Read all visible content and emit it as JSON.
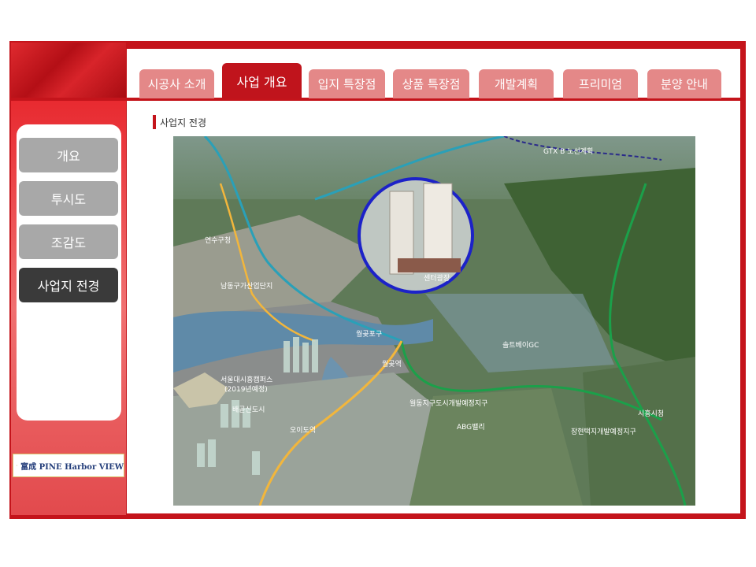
{
  "nav": {
    "tabs": [
      {
        "label": "시공사 소개"
      },
      {
        "label": "사업 개요"
      },
      {
        "label": "입지 특장점"
      },
      {
        "label": "상품 특장점"
      },
      {
        "label": "개발계획"
      },
      {
        "label": "프리미엄"
      },
      {
        "label": "분양 안내"
      }
    ],
    "active_tab": "사업 개요"
  },
  "sidebar": {
    "items": [
      {
        "label": "개요"
      },
      {
        "label": "투시도"
      },
      {
        "label": "조감도"
      },
      {
        "label": "사업지 전경"
      }
    ],
    "active_item": "사업지 전경"
  },
  "brand": {
    "name": "富成 PINE Harbor VIEW"
  },
  "section": {
    "title": "사업지 전경"
  },
  "map": {
    "labels": [
      "연수구청",
      "남동구가산업단지",
      "솔트베이GC",
      "서울대시흥캠퍼스",
      "(2019년예정)",
      "배곧신도시",
      "월곶포구",
      "월곶역",
      "월동지구도시개발예정지구",
      "장현택지개발예정지구",
      "시흥시청",
      "GTX B 노선계획",
      "오이도역",
      "ABG밸리",
      "센터광장"
    ]
  },
  "colors": {
    "accent": "#c4141b",
    "tab_inactive": "#e48888",
    "side_inactive": "#a8a8a8",
    "side_active": "#3a3a3a"
  }
}
